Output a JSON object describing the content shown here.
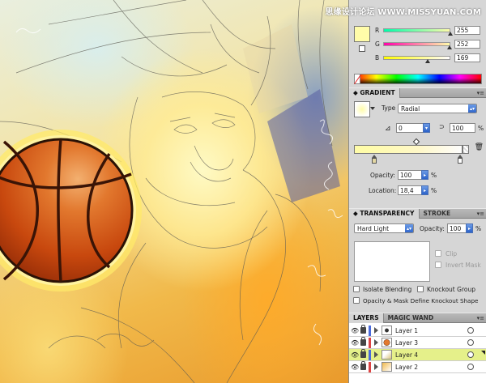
{
  "watermark": "思缘设计论坛 WWW.MISSYUAN.COM",
  "colors": {
    "fill": "#fffca9",
    "accent_blue": "#2b62c9",
    "selected_layer": "#e5f08a"
  },
  "color_panel": {
    "channels": [
      {
        "label": "R",
        "value": "255",
        "fraction": 1.0
      },
      {
        "label": "G",
        "value": "252",
        "fraction": 0.988
      },
      {
        "label": "B",
        "value": "169",
        "fraction": 0.663
      }
    ]
  },
  "gradient_panel": {
    "tab_label": "GRADIENT",
    "type_label": "Type",
    "type_value": "Radial",
    "angle_value": "0",
    "aspect_value": "100",
    "aspect_unit": "%",
    "opacity_label": "Opacity:",
    "opacity_value": "100",
    "opacity_unit": "%",
    "location_label": "Location:",
    "location_value": "18,4",
    "location_unit": "%"
  },
  "transparency_panel": {
    "tab_label": "TRANSPARENCY",
    "tab2_label": "STROKE",
    "blend_mode": "Hard Light",
    "opacity_label": "Opacity:",
    "opacity_value": "100",
    "opacity_unit": "%",
    "clip_label": "Clip",
    "invert_mask_label": "Invert Mask",
    "isolate_blending_label": "Isolate Blending",
    "knockout_group_label": "Knockout Group",
    "opacity_mask_label": "Opacity & Mask Define Knockout Shape"
  },
  "layers_panel": {
    "tab_label": "LAYERS",
    "tab2_label": "MAGIC WAND",
    "layers": [
      {
        "name": "Layer 1",
        "color": "#4a6bdc",
        "selected": false
      },
      {
        "name": "Layer 3",
        "color": "#d44",
        "selected": false
      },
      {
        "name": "Layer 4",
        "color": "#4a6bdc",
        "selected": true
      },
      {
        "name": "Layer 2",
        "color": "#d44",
        "selected": false
      }
    ]
  }
}
